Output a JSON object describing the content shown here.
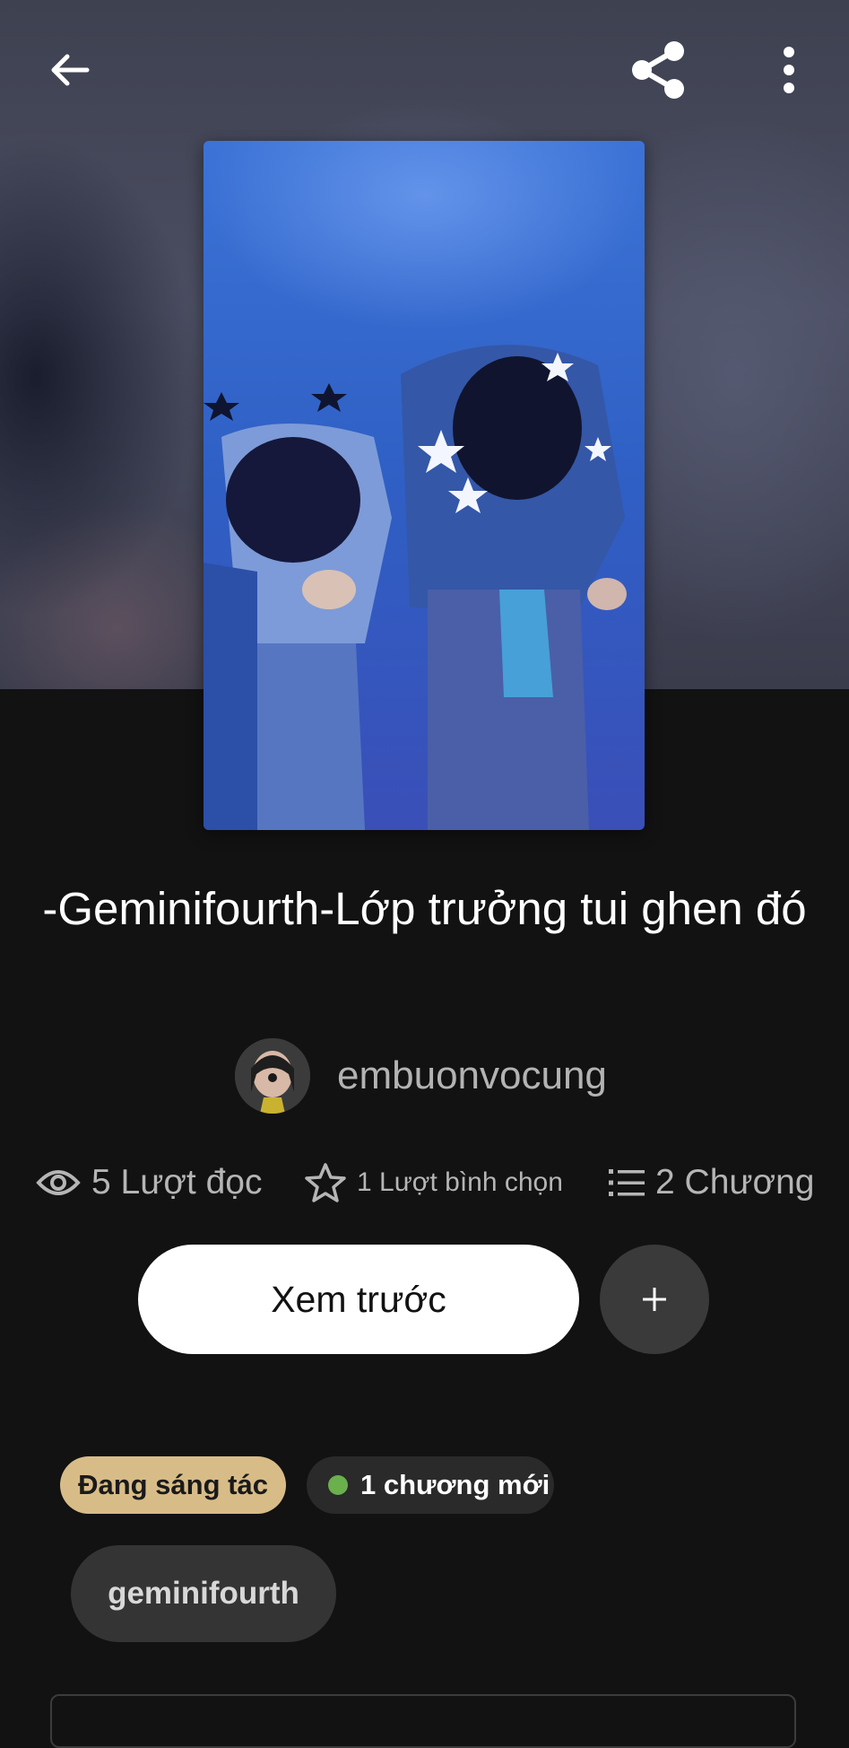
{
  "topbar": {
    "back_icon": "arrow-left-icon",
    "share_icon": "share-icon",
    "more_icon": "more-vertical-icon"
  },
  "story": {
    "title": "-Geminifourth-Lớp trưởng tui ghen đó",
    "author": "embuonvocung"
  },
  "stats": {
    "reads": "5 Lượt đọc",
    "votes": "1 Lượt bình chọn",
    "chapters": "2 Chương"
  },
  "actions": {
    "preview_label": "Xem trước",
    "add_icon": "plus-icon"
  },
  "badges": {
    "status": "Đang sáng tác",
    "new_chapters": "1 chương mới"
  },
  "tags": [
    "geminifourth"
  ],
  "colors": {
    "background": "#121212",
    "status_badge": "#d8bc88",
    "new_dot": "#6ab04c",
    "muted_text": "#b5b5b5"
  }
}
